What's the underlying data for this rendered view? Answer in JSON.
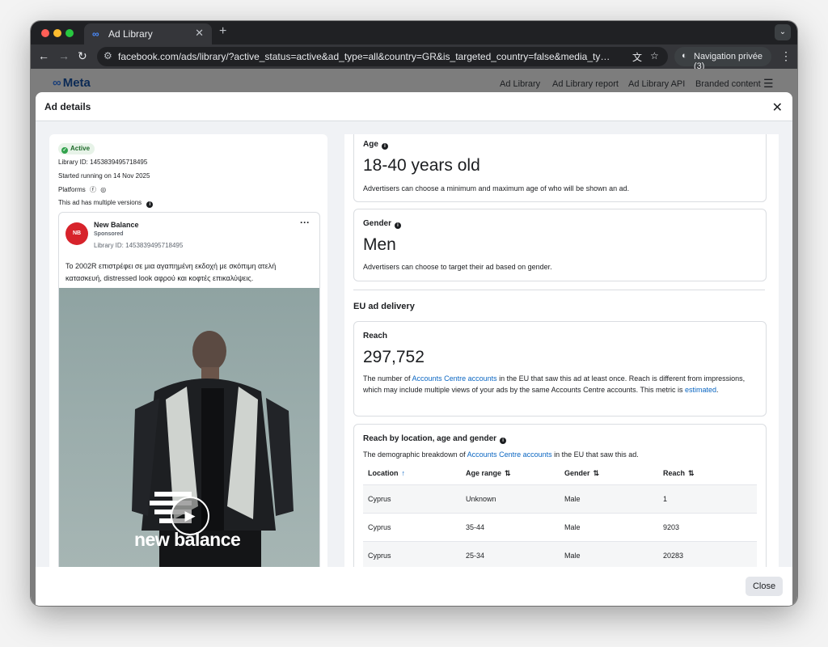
{
  "browser": {
    "tab_title": "Ad Library",
    "tab_favicon": "Meta logo",
    "url": "facebook.com/ads/library/?active_status=active&ad_type=all&country=GR&is_targeted_country=false&media_type=all&search_type=p...",
    "profile_label": "Navigation privée (3)",
    "icons": [
      "back-arrow",
      "forward-arrow",
      "reload",
      "translate",
      "star",
      "incognito",
      "menu"
    ]
  },
  "site": {
    "logo_text": "Meta",
    "nav": [
      "Ad Library",
      "Ad Library report",
      "Ad Library API",
      "Branded content"
    ]
  },
  "modal": {
    "title": "Ad details",
    "close_label": "Close"
  },
  "ad_info": {
    "status": "Active",
    "library_id": "Library ID: 1453839495718495",
    "started": "Started running on 14 Nov 2025",
    "platforms_label": "Platforms",
    "multiple_versions": "This ad has multiple versions"
  },
  "ad_card": {
    "advertiser": "New Balance",
    "sponsored": "Sponsored",
    "library_id": "Library ID: 1453839495718495",
    "text": "Το 2002R επιστρέφει σε μια αγαπημένη εκδοχή με σκόπιμη ατελή κατασκευή, distressed look αφρού και κοφτές επικαλύψεις.",
    "image_wordmark": "new balance"
  },
  "targeting": {
    "age_title": "Age",
    "age_value": "18-40 years old",
    "age_desc": "Advertisers can choose a minimum and maximum age of who will be shown an ad.",
    "gender_title": "Gender",
    "gender_value": "Men",
    "gender_desc": "Advertisers can choose to target their ad based on gender."
  },
  "eu_delivery": {
    "section_title": "EU ad delivery",
    "reach_title": "Reach",
    "reach_value": "297,752",
    "reach_desc_1": "The number of ",
    "reach_desc_link": "Accounts Centre accounts",
    "reach_desc_2": " in the EU that saw this ad at least once. Reach is different from impressions, which may include multiple views of your ads by the same Accounts Centre accounts. This metric is ",
    "reach_desc_link2": "estimated",
    "reach_desc_3": "."
  },
  "breakdown": {
    "title": "Reach by location, age and gender",
    "desc_1": "The demographic breakdown of ",
    "desc_link": "Accounts Centre accounts",
    "desc_2": " in the EU that saw this ad.",
    "columns": [
      "Location",
      "Age range",
      "Gender",
      "Reach"
    ],
    "rows": [
      [
        "Cyprus",
        "Unknown",
        "Male",
        "1"
      ],
      [
        "Cyprus",
        "35-44",
        "Male",
        "9203"
      ],
      [
        "Cyprus",
        "25-34",
        "Male",
        "20283"
      ]
    ]
  },
  "colors": {
    "link": "#0a66c2",
    "active_badge": "#31a24c",
    "brand_red": "#d7232b"
  }
}
